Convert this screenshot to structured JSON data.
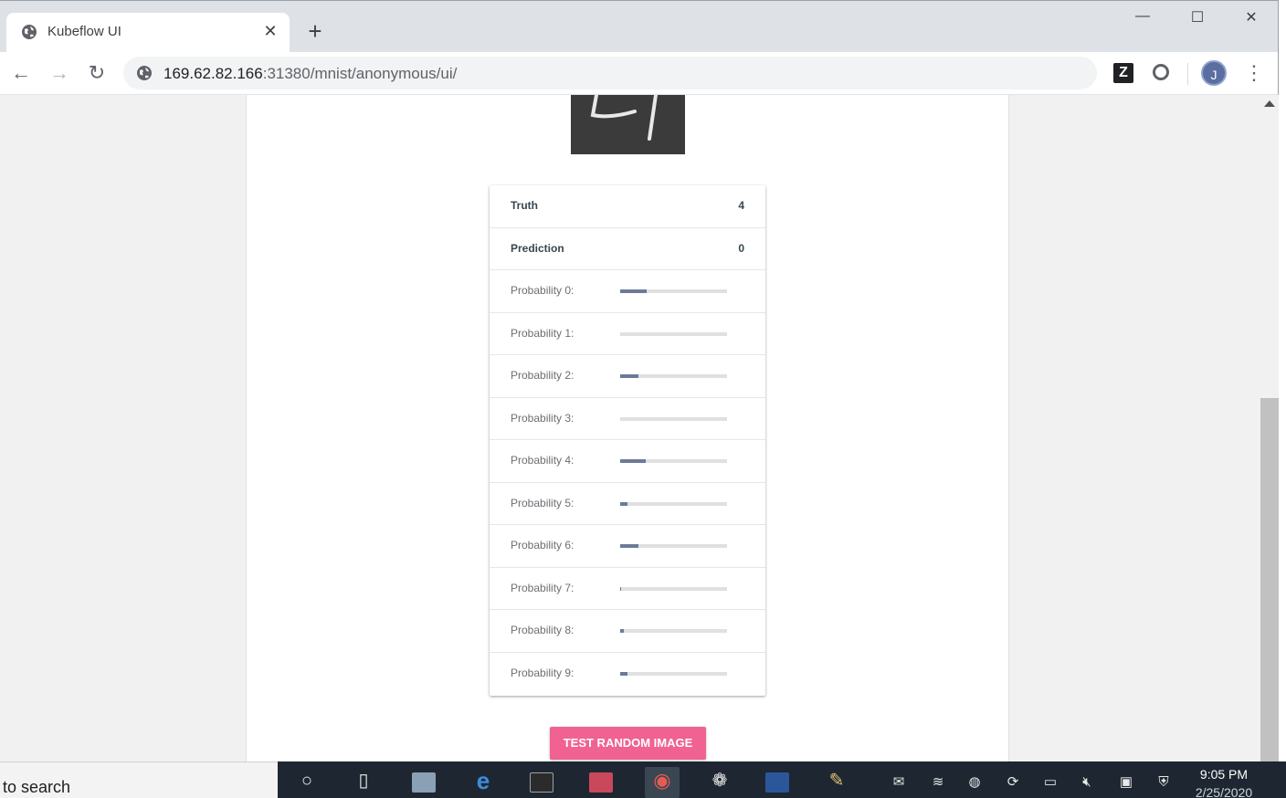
{
  "browser": {
    "tab_title": "Kubeflow UI",
    "tab_close": "✕",
    "new_tab": "+",
    "window_controls": {
      "minimize": "—",
      "maximize": "☐",
      "close": "✕"
    },
    "nav": {
      "back": "←",
      "forward": "→",
      "reload": "↻"
    },
    "url_host": "169.62.82.166",
    "url_path": ":31380/mnist/anonymous/ui/",
    "extension_z": "Z",
    "profile_initial": "J",
    "menu": "⋮"
  },
  "results": {
    "truth_label": "Truth",
    "truth_value": "4",
    "prediction_label": "Prediction",
    "prediction_value": "0",
    "probabilities": [
      {
        "label": "Probability 0:",
        "value": 0.25
      },
      {
        "label": "Probability 1:",
        "value": 0.0
      },
      {
        "label": "Probability 2:",
        "value": 0.17
      },
      {
        "label": "Probability 3:",
        "value": 0.0
      },
      {
        "label": "Probability 4:",
        "value": 0.24
      },
      {
        "label": "Probability 5:",
        "value": 0.07
      },
      {
        "label": "Probability 6:",
        "value": 0.17
      },
      {
        "label": "Probability 7:",
        "value": 0.01
      },
      {
        "label": "Probability 8:",
        "value": 0.03
      },
      {
        "label": "Probability 9:",
        "value": 0.07
      }
    ],
    "bar_fill_color": "#6b7a99",
    "bar_track_color": "#e0e0e0"
  },
  "action": {
    "test_button": "TEST RANDOM IMAGE",
    "button_color": "#f06292"
  },
  "taskbar": {
    "search_text": "to search",
    "clock_time": "9:05 PM",
    "clock_date": "2/25/2020",
    "pinned_icons": [
      "cortana-icon",
      "task-view-icon",
      "notepad-icon",
      "edge-icon",
      "terminal-icon",
      "folder-icon",
      "chrome-icon",
      "gift-icon",
      "word-icon",
      "paint-icon"
    ],
    "tray_icons": [
      "mail-icon",
      "wifi-icon",
      "security-icon",
      "sync-icon",
      "battery-icon",
      "volume-muted-icon",
      "display-icon",
      "shield-icon"
    ]
  }
}
